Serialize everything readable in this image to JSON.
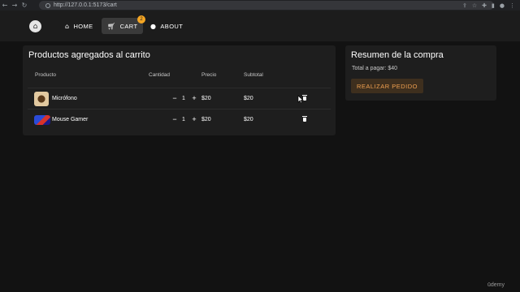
{
  "browser": {
    "url": "http://127.0.0.1:5173/cart"
  },
  "appbar": {
    "nav": [
      {
        "label": "HOME",
        "icon": "home-icon"
      },
      {
        "label": "CART",
        "icon": "cart-icon",
        "badge": "2"
      },
      {
        "label": "ABOUT",
        "icon": "info-icon"
      }
    ]
  },
  "cart": {
    "title": "Productos agregados al carrito",
    "headers": {
      "product": "Producto",
      "quantity": "Cantidad",
      "price": "Precio",
      "subtotal": "Subtotal"
    },
    "rows": [
      {
        "name": "Micrófono",
        "qty": "1",
        "price": "$20",
        "subtotal": "$20",
        "minus": "−",
        "plus": "+"
      },
      {
        "name": "Mouse Gamer",
        "qty": "1",
        "price": "$20",
        "subtotal": "$20",
        "minus": "−",
        "plus": "+"
      }
    ]
  },
  "summary": {
    "title": "Resumen de la compra",
    "total": "Total a pagar: $40",
    "button": "REALIZAR PEDIDO"
  },
  "watermark": "ūdemy",
  "colors": {
    "accent": "#f5a623",
    "order_button_text": "#f0a050",
    "panel": "#1e1e1e",
    "background": "#121212"
  }
}
